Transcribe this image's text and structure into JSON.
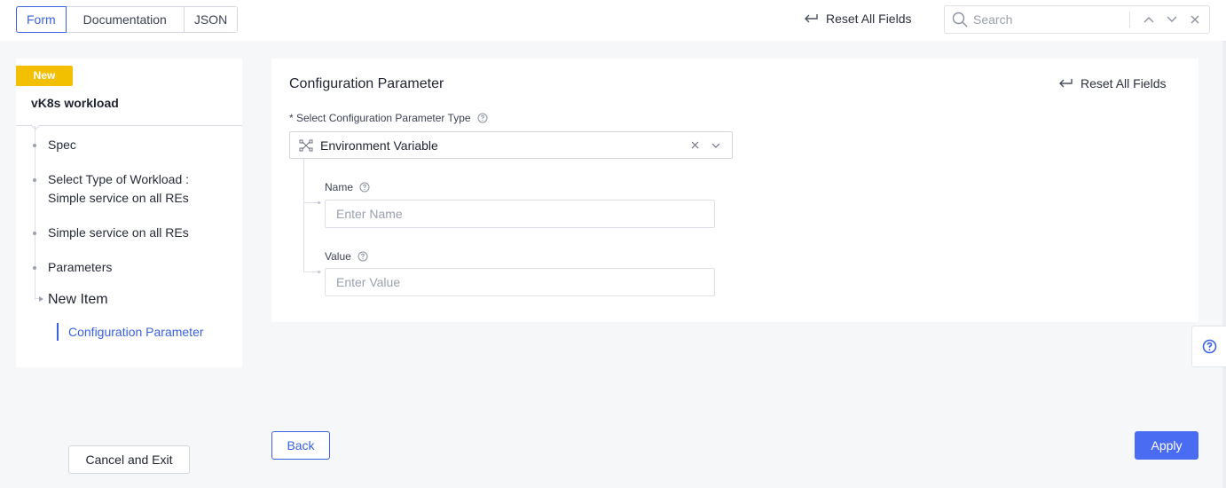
{
  "topbar": {
    "tabs": [
      {
        "label": "Form",
        "active": true
      },
      {
        "label": "Documentation",
        "active": false
      },
      {
        "label": "JSON",
        "active": false
      }
    ],
    "reset_label": "Reset All Fields",
    "search": {
      "placeholder": "Search",
      "value": ""
    }
  },
  "sidebar": {
    "badge": "New",
    "title": "vK8s workload",
    "items": [
      {
        "label": "Spec"
      },
      {
        "label": "Select Type of Workload : Simple service on all REs"
      },
      {
        "label": "Simple service on all REs"
      },
      {
        "label": "Parameters"
      },
      {
        "label": "New Item"
      }
    ],
    "sub_item": "Configuration Parameter"
  },
  "card": {
    "title": "Configuration Parameter",
    "reset_label": "Reset All Fields",
    "type_label": "* Select Configuration Parameter Type",
    "type_value": "Environment Variable",
    "name": {
      "label": "Name",
      "placeholder": "Enter Name",
      "value": ""
    },
    "value": {
      "label": "Value",
      "placeholder": "Enter Value",
      "value": ""
    }
  },
  "footer": {
    "cancel_label": "Cancel and Exit",
    "back_label": "Back",
    "apply_label": "Apply"
  },
  "colors": {
    "accent": "#3a62e0",
    "apply": "#4a6cf2",
    "badge": "#f2c000",
    "background": "#f6f7f9"
  },
  "icons": [
    "return-arrow-icon",
    "search-icon",
    "chevron-up-icon",
    "chevron-down-icon",
    "close-icon",
    "env-variable-icon",
    "help-circle-icon",
    "question-icon"
  ]
}
